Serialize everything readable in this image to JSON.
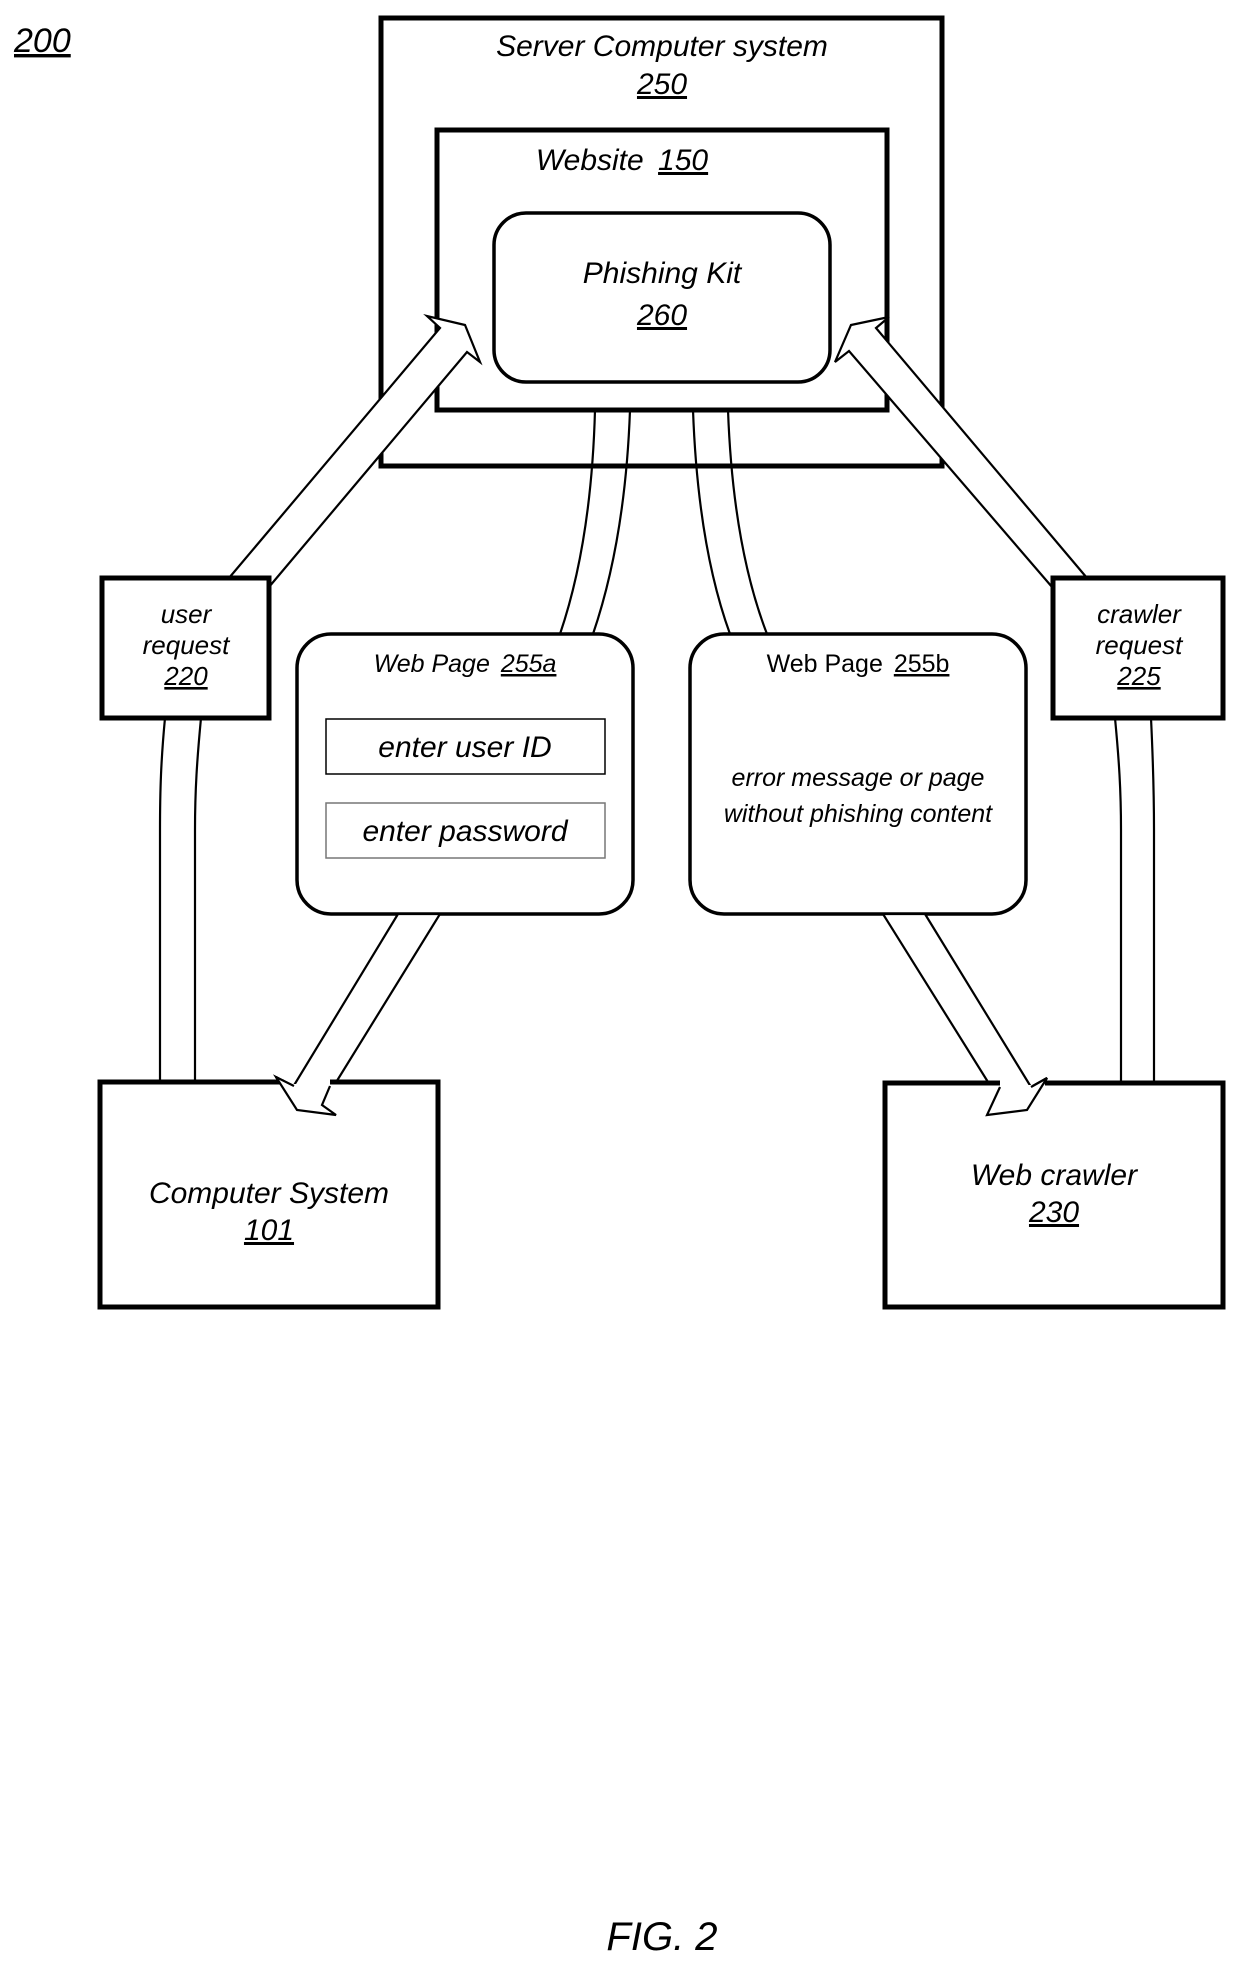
{
  "figure": {
    "ref_number": "200",
    "caption": "FIG. 2"
  },
  "server": {
    "title": "Server Computer system",
    "ref": "250"
  },
  "website": {
    "title": "Website",
    "ref": "150"
  },
  "phishing_kit": {
    "title": "Phishing Kit",
    "ref": "260"
  },
  "user_request": {
    "line1": "user",
    "line2": "request",
    "ref": "220"
  },
  "crawler_request": {
    "line1": "crawler",
    "line2": "request",
    "ref": "225"
  },
  "web_page_a": {
    "title": "Web Page",
    "ref": "255a",
    "fields": [
      "enter user ID",
      "enter password"
    ]
  },
  "web_page_b": {
    "title": "Web Page",
    "ref": "255b",
    "line1": "error message or page",
    "line2": "without phishing content"
  },
  "computer_system": {
    "title": "Computer System",
    "ref": "101"
  },
  "web_crawler": {
    "title": "Web crawler",
    "ref": "230"
  }
}
